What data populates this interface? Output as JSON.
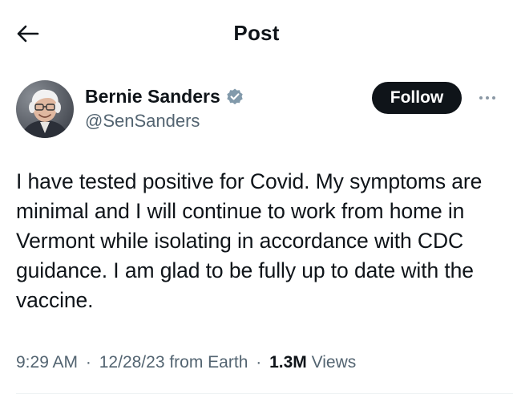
{
  "header": {
    "title": "Post",
    "back_icon": "back-arrow-icon"
  },
  "author": {
    "name": "Bernie Sanders",
    "handle": "@SenSanders",
    "verified": true,
    "verified_color": "#829aab",
    "avatar_icon": "avatar-photo"
  },
  "actions": {
    "follow_label": "Follow",
    "more_icon": "more-options-icon"
  },
  "tweet": {
    "text": "I have tested positive for Covid. My symptoms are minimal and I will continue to work from home in Vermont while isolating in accordance with CDC guidance. I am glad to be fully up to date with the vaccine."
  },
  "meta": {
    "time": "9:29 AM",
    "date": "12/28/23",
    "source": "from Earth",
    "separator": "·",
    "views_count": "1.3M",
    "views_label": "Views"
  },
  "colors": {
    "text_primary": "#0f1419",
    "text_secondary": "#536471",
    "follow_bg": "#0f1419",
    "follow_text": "#ffffff"
  }
}
